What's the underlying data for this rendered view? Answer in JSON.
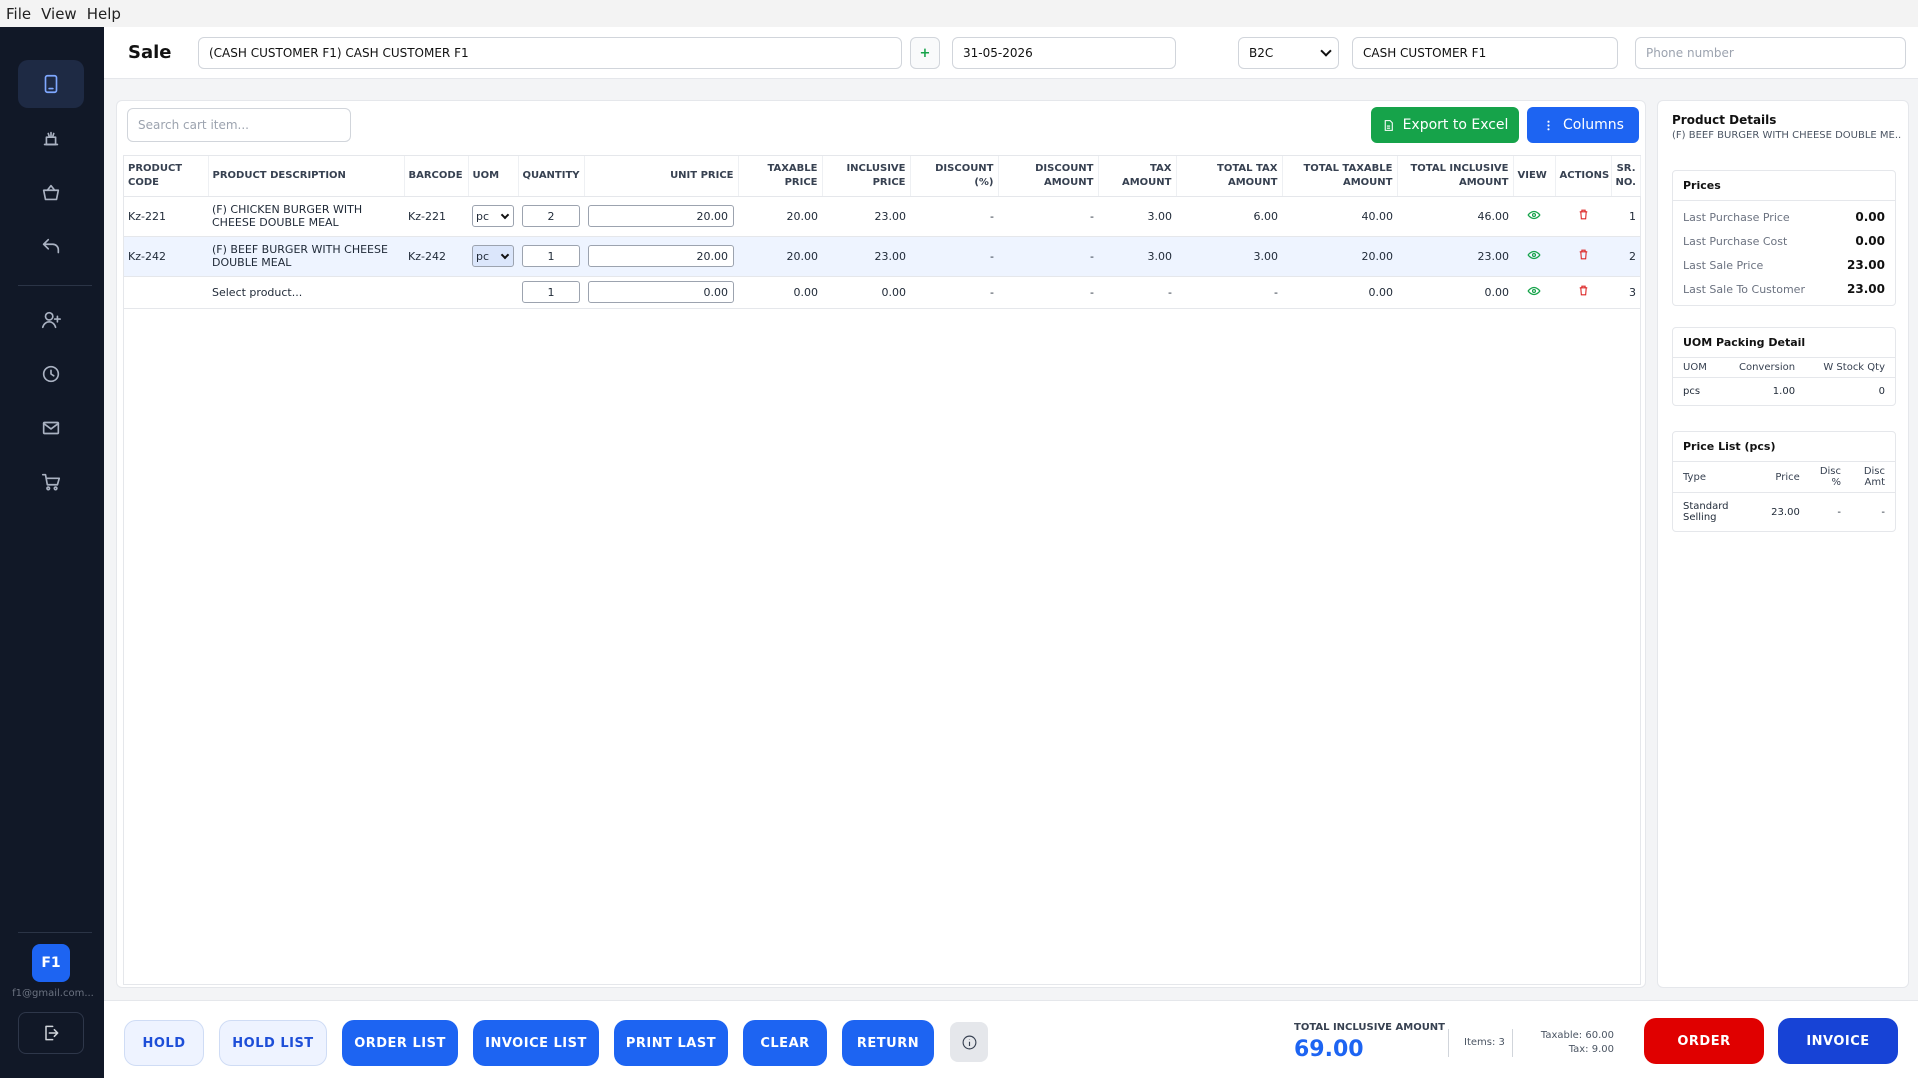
{
  "menu": {
    "file": "File",
    "view": "View",
    "help": "Help"
  },
  "sidebar": {
    "avatar_initials": "F1",
    "email": "f1@gmail.com..."
  },
  "header": {
    "title": "Sale",
    "customer_value": "(CASH CUSTOMER F1) CASH CUSTOMER F1",
    "add_label": "+",
    "date_value": "31-05-2026",
    "type_value": "B2C",
    "customer_name_value": "CASH CUSTOMER F1",
    "phone_placeholder": "Phone number"
  },
  "toolbar": {
    "search_placeholder": "Search cart item...",
    "export_label": "Export to Excel",
    "columns_label": "Columns"
  },
  "table": {
    "headers": {
      "code": "PRODUCT CODE",
      "desc": "PRODUCT DESCRIPTION",
      "barcode": "BARCODE",
      "uom": "UOM",
      "qty": "QUANTITY",
      "unit_price": "UNIT PRICE",
      "taxable_price": "TAXABLE PRICE",
      "incl_price": "INCLUSIVE PRICE",
      "disc_pct": "DISCOUNT (%)",
      "disc_amt": "DISCOUNT AMOUNT",
      "tax_amt": "TAX AMOUNT",
      "total_tax": "TOTAL TAX AMOUNT",
      "total_taxable": "TOTAL TAXABLE AMOUNT",
      "total_incl": "TOTAL INCLUSIVE AMOUNT",
      "view": "VIEW",
      "actions": "ACTIONS",
      "sr": "SR. NO."
    },
    "rows": [
      {
        "code": "Kz-221",
        "desc": "(F) CHICKEN BURGER WITH CHEESE DOUBLE MEAL",
        "barcode": "Kz-221",
        "uom": "pc",
        "qty": "2",
        "unit_price": "20.00",
        "taxable_price": "20.00",
        "incl_price": "23.00",
        "disc_pct": "-",
        "disc_amt": "-",
        "tax_amt": "3.00",
        "total_tax": "6.00",
        "total_taxable": "40.00",
        "total_incl": "46.00",
        "sr": "1"
      },
      {
        "code": "Kz-242",
        "desc": "(F) BEEF BURGER WITH CHEESE DOUBLE MEAL",
        "barcode": "Kz-242",
        "uom": "pc",
        "qty": "1",
        "unit_price": "20.00",
        "taxable_price": "20.00",
        "incl_price": "23.00",
        "disc_pct": "-",
        "disc_amt": "-",
        "tax_amt": "3.00",
        "total_tax": "3.00",
        "total_taxable": "20.00",
        "total_incl": "23.00",
        "sr": "2"
      },
      {
        "code": "",
        "desc": "Select product...",
        "barcode": "",
        "uom": "",
        "qty": "1",
        "unit_price": "0.00",
        "taxable_price": "0.00",
        "incl_price": "0.00",
        "disc_pct": "-",
        "disc_amt": "-",
        "tax_amt": "-",
        "total_tax": "-",
        "total_taxable": "0.00",
        "total_incl": "0.00",
        "sr": "3"
      }
    ]
  },
  "details": {
    "title": "Product Details",
    "subtitle": "(F) BEEF BURGER WITH CHEESE DOUBLE ME...",
    "prices": {
      "title": "Prices",
      "items": [
        {
          "label": "Last Purchase Price",
          "value": "0.00"
        },
        {
          "label": "Last Purchase Cost",
          "value": "0.00"
        },
        {
          "label": "Last Sale Price",
          "value": "23.00"
        },
        {
          "label": "Last Sale To Customer",
          "value": "23.00"
        }
      ]
    },
    "uom": {
      "title": "UOM Packing Detail",
      "headers": [
        "UOM",
        "Conversion",
        "W Stock Qty"
      ],
      "row": [
        "pcs",
        "1.00",
        "0"
      ]
    },
    "pricelist": {
      "title": "Price List (pcs)",
      "headers": [
        "Type",
        "Price",
        "Disc %",
        "Disc Amt"
      ],
      "row": [
        "Standard Selling",
        "23.00",
        "-",
        "-"
      ]
    }
  },
  "footer": {
    "hold": "HOLD",
    "hold_list": "HOLD LIST",
    "order_list": "ORDER LIST",
    "invoice_list": "INVOICE LIST",
    "print_last": "PRINT LAST",
    "clear": "CLEAR",
    "return": "RETURN",
    "total_label": "TOTAL INCLUSIVE AMOUNT",
    "total_value": "69.00",
    "items": "Items: 3",
    "taxable": "Taxable: 60.00",
    "tax": "Tax: 9.00",
    "order": "ORDER",
    "invoice": "INVOICE"
  },
  "colors": {
    "primary": "#1d64f2",
    "success": "#16a34a",
    "danger": "#e00000",
    "sidebar": "#111827"
  }
}
